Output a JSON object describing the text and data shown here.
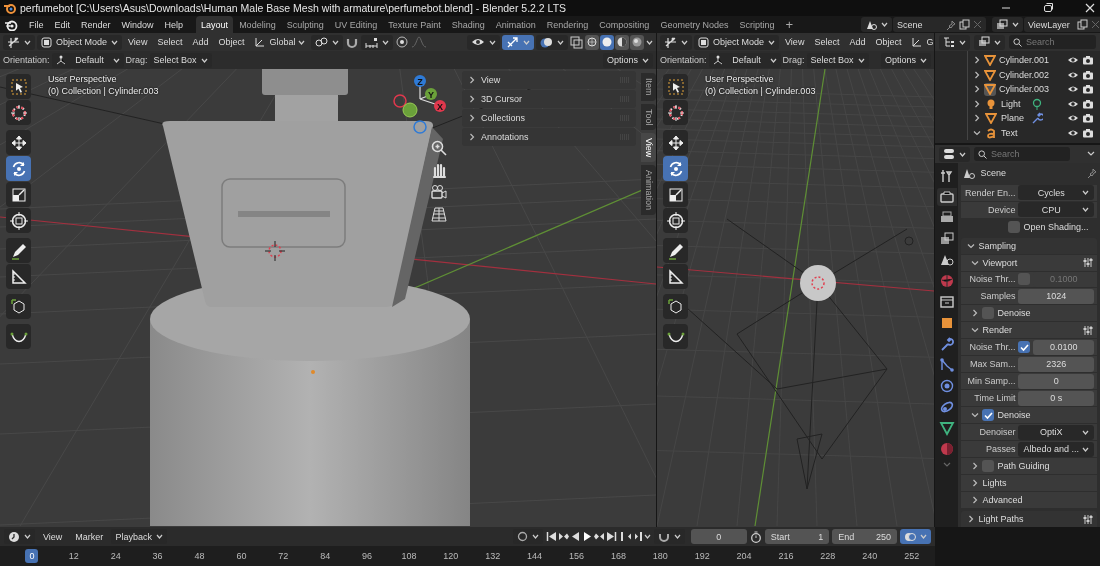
{
  "window": {
    "title": "perfumebot [C:\\Users\\Asus\\Downloads\\Human Male Base Mesh with armature\\perfumebot.blend] - Blender 5.2.2 LTS"
  },
  "menu": [
    "File",
    "Edit",
    "Render",
    "Window",
    "Help"
  ],
  "workspaces": [
    {
      "label": "Layout",
      "selected": true
    },
    {
      "label": "Modeling",
      "selected": false
    },
    {
      "label": "Sculpting",
      "selected": false
    },
    {
      "label": "UV Editing",
      "selected": false
    },
    {
      "label": "Texture Paint",
      "selected": false
    },
    {
      "label": "Shading",
      "selected": false
    },
    {
      "label": "Animation",
      "selected": false
    },
    {
      "label": "Rendering",
      "selected": false
    },
    {
      "label": "Compositing",
      "selected": false
    },
    {
      "label": "Geometry Nodes",
      "selected": false
    },
    {
      "label": "Scripting",
      "selected": false
    }
  ],
  "add_workspace": "+",
  "scene": {
    "name": "Scene"
  },
  "view_layer": {
    "name": "ViewLayer"
  },
  "viewports": [
    {
      "kind": "closeup",
      "mode": "Object Mode",
      "menus": [
        "View",
        "Select",
        "Add",
        "Object"
      ],
      "transform_orientation": "Global",
      "shading": [
        {
          "selected": false
        },
        {
          "selected": true
        },
        {
          "selected": false
        },
        {
          "selected": false
        }
      ],
      "orientation_label": "Orientation:",
      "orientation": "Default",
      "drag_label": "Drag:",
      "drag": "Select Box",
      "options": "Options",
      "view_name": "User Perspective",
      "view_info": "(0) Collection | Cylinder.003",
      "tools": [
        {
          "kind": "select",
          "selected": false
        },
        {
          "kind": "cursor",
          "selected": false
        },
        {
          "kind": "move",
          "selected": false
        },
        {
          "kind": "rotate",
          "selected": true
        },
        {
          "kind": "scale",
          "selected": false
        },
        {
          "kind": "transform",
          "selected": false
        },
        {
          "kind": "annotate",
          "selected": false
        },
        {
          "kind": "measure",
          "selected": false
        },
        {
          "kind": "add-cube",
          "selected": false
        },
        {
          "kind": "curve",
          "selected": false
        }
      ],
      "gizmo_axes": [
        "X",
        "Y",
        "Z"
      ],
      "sidebar_panels": [
        {
          "label": "View",
          "expanded": false
        },
        {
          "label": "3D Cursor",
          "expanded": false
        },
        {
          "label": "Collections",
          "expanded": false
        },
        {
          "label": "Annotations",
          "expanded": false
        }
      ],
      "sidebar_tabs": [
        {
          "label": "Item",
          "selected": false
        },
        {
          "label": "Tool",
          "selected": false
        },
        {
          "label": "View",
          "selected": true
        },
        {
          "label": "Animation",
          "selected": false
        }
      ]
    },
    {
      "kind": "overview",
      "mode": "Object Mode",
      "menus": [
        "View",
        "Select",
        "Add",
        "Object"
      ],
      "transform_orientation": "G",
      "orientation_label": "Orientation:",
      "orientation": "Default",
      "drag_label": "Drag:",
      "drag": "Select Box",
      "options": "Options",
      "view_name": "User Perspective",
      "view_info": "(0) Collection | Cylinder.003",
      "tools": [
        {
          "kind": "select",
          "selected": false
        },
        {
          "kind": "cursor",
          "selected": false
        },
        {
          "kind": "move",
          "selected": false
        },
        {
          "kind": "rotate",
          "selected": true
        },
        {
          "kind": "scale",
          "selected": false
        },
        {
          "kind": "transform",
          "selected": false
        },
        {
          "kind": "annotate",
          "selected": false
        },
        {
          "kind": "measure",
          "selected": false
        },
        {
          "kind": "add-cube",
          "selected": false
        },
        {
          "kind": "curve",
          "selected": false
        }
      ]
    }
  ],
  "outliner": {
    "search_placeholder": "Search",
    "items": [
      {
        "name": "Cylinder.001",
        "kind": "mesh",
        "expanded": false,
        "selected": false,
        "modifier": false
      },
      {
        "name": "Cylinder.002",
        "kind": "mesh",
        "expanded": false,
        "selected": false,
        "modifier": false
      },
      {
        "name": "Cylinder.003",
        "kind": "mesh",
        "expanded": false,
        "selected": true,
        "modifier": false
      },
      {
        "name": "Light",
        "kind": "light",
        "expanded": false,
        "selected": false,
        "modifier": false
      },
      {
        "name": "Plane",
        "kind": "mesh",
        "expanded": false,
        "selected": false,
        "modifier": true
      },
      {
        "name": "Text",
        "kind": "text",
        "expanded": true,
        "selected": false,
        "modifier": false
      }
    ]
  },
  "properties": {
    "search_placeholder": "Search",
    "context": "Scene",
    "tabs": [
      {
        "kind": "tool",
        "selected": false
      },
      {
        "kind": "render",
        "selected": true
      },
      {
        "kind": "output",
        "selected": false
      },
      {
        "kind": "view-layer",
        "selected": false
      },
      {
        "kind": "scene",
        "selected": false
      },
      {
        "kind": "world",
        "selected": false
      },
      {
        "kind": "collection",
        "selected": false
      },
      {
        "kind": "object",
        "selected": false
      },
      {
        "kind": "modifier",
        "selected": false
      },
      {
        "kind": "particles",
        "selected": false
      },
      {
        "kind": "physics",
        "selected": false
      },
      {
        "kind": "constraints",
        "selected": false
      },
      {
        "kind": "data",
        "selected": false
      },
      {
        "kind": "material",
        "selected": false
      }
    ],
    "rows": [
      {
        "kind": "select",
        "label": "Render En...",
        "value": "Cycles"
      },
      {
        "kind": "select",
        "label": "Device",
        "value": "CPU"
      },
      {
        "kind": "checkbox",
        "label": "Open Shading...",
        "checked": false
      },
      {
        "kind": "section",
        "label": "Sampling",
        "expanded": true,
        "presets": false
      },
      {
        "kind": "subsection",
        "label": "Viewport",
        "expanded": true,
        "presets": true
      },
      {
        "kind": "checknumber",
        "label": "Noise Thr...",
        "checked": false,
        "value": "0.1000"
      },
      {
        "kind": "number",
        "label": "Samples",
        "value": "1024"
      },
      {
        "kind": "subsection-check",
        "label": "Denoise",
        "expanded": false,
        "checked": false
      },
      {
        "kind": "subsection",
        "label": "Render",
        "expanded": true,
        "presets": true
      },
      {
        "kind": "checknumber",
        "label": "Noise Thr...",
        "checked": true,
        "value": "0.0100"
      },
      {
        "kind": "number",
        "label": "Max Sam...",
        "value": "2326"
      },
      {
        "kind": "number",
        "label": "Min Samp...",
        "value": "0"
      },
      {
        "kind": "number",
        "label": "Time Limit",
        "value": "0 s"
      },
      {
        "kind": "subsection-check",
        "label": "Denoise",
        "expanded": true,
        "checked": true
      },
      {
        "kind": "select",
        "label": "Denoiser",
        "value": "OptiX"
      },
      {
        "kind": "select",
        "label": "Passes",
        "value": "Albedo and ..."
      },
      {
        "kind": "subsection-check",
        "label": "Path Guiding",
        "expanded": false,
        "checked": false
      },
      {
        "kind": "subsection",
        "label": "Lights",
        "expanded": false,
        "presets": false
      },
      {
        "kind": "subsection",
        "label": "Advanced",
        "expanded": false,
        "presets": false
      },
      {
        "kind": "section",
        "label": "Light Paths",
        "expanded": false,
        "presets": true
      }
    ]
  },
  "timeline": {
    "menus": [
      "View",
      "Marker"
    ],
    "playback": "Playback",
    "current_frame": "0",
    "start_label": "Start",
    "start": "1",
    "end_label": "End",
    "end": "250",
    "ruler": [
      {
        "label": "0",
        "selected": true
      },
      {
        "label": "12",
        "selected": false
      },
      {
        "label": "24",
        "selected": false
      },
      {
        "label": "36",
        "selected": false
      },
      {
        "label": "48",
        "selected": false
      },
      {
        "label": "60",
        "selected": false
      },
      {
        "label": "72",
        "selected": false
      },
      {
        "label": "84",
        "selected": false
      },
      {
        "label": "96",
        "selected": false
      },
      {
        "label": "108",
        "selected": false
      },
      {
        "label": "120",
        "selected": false
      },
      {
        "label": "132",
        "selected": false
      },
      {
        "label": "144",
        "selected": false
      },
      {
        "label": "156",
        "selected": false
      },
      {
        "label": "168",
        "selected": false
      },
      {
        "label": "180",
        "selected": false
      },
      {
        "label": "192",
        "selected": false
      },
      {
        "label": "204",
        "selected": false
      },
      {
        "label": "216",
        "selected": false
      },
      {
        "label": "228",
        "selected": false
      },
      {
        "label": "240",
        "selected": false
      },
      {
        "label": "252",
        "selected": false
      }
    ]
  }
}
